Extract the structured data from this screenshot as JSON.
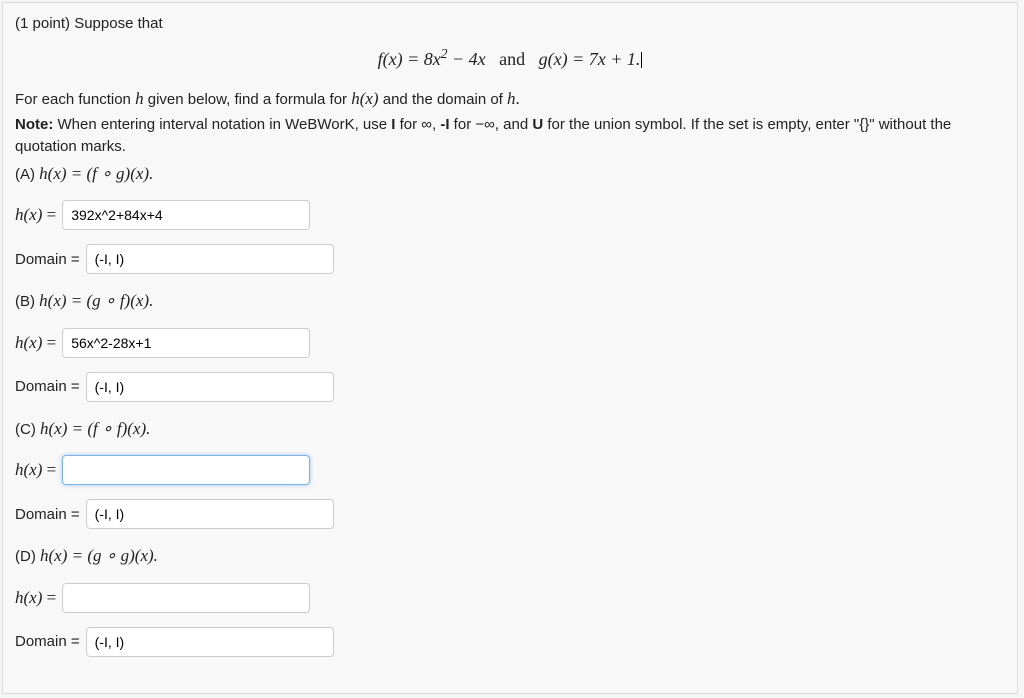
{
  "points": "(1 point)",
  "intro": "Suppose that",
  "equation_html": "f(x) = 8x<sup>2</sup> − 4x&nbsp;&nbsp;&nbsp;<span class='upright'>and</span>&nbsp;&nbsp;&nbsp;g(x) = 7x + 1.",
  "para1_a": "For each function ",
  "para1_b": " given below, find a formula for ",
  "para1_c": " and the domain of ",
  "note_label": "Note:",
  "note_body_a": " When entering interval notation in WeBWorK, use ",
  "note_body_b": " for ∞, ",
  "note_body_c": " for −∞, and ",
  "note_body_d": " for the union symbol. If the set is empty, enter \"{}\" without the quotation marks.",
  "h_symbol": "h",
  "hx_symbol": "h(x)",
  "I": "I",
  "negI": "-I",
  "U": "U",
  "domain_label": "Domain =",
  "hx_label": "h(x) =",
  "parts": {
    "A": {
      "label": "(A) ",
      "expr": "h(x) = (f ∘ g)(x).",
      "hx_val": "392x^2+84x+4",
      "domain_val": "(-I, I)"
    },
    "B": {
      "label": "(B) ",
      "expr": "h(x) = (g ∘ f)(x).",
      "hx_val": "56x^2-28x+1",
      "domain_val": "(-I, I)"
    },
    "C": {
      "label": "(C) ",
      "expr": "h(x) = (f ∘ f)(x).",
      "hx_val": "",
      "domain_val": "(-I, I)"
    },
    "D": {
      "label": "(D) ",
      "expr": "h(x) = (g ∘ g)(x).",
      "hx_val": "",
      "domain_val": "(-I, I)"
    }
  }
}
